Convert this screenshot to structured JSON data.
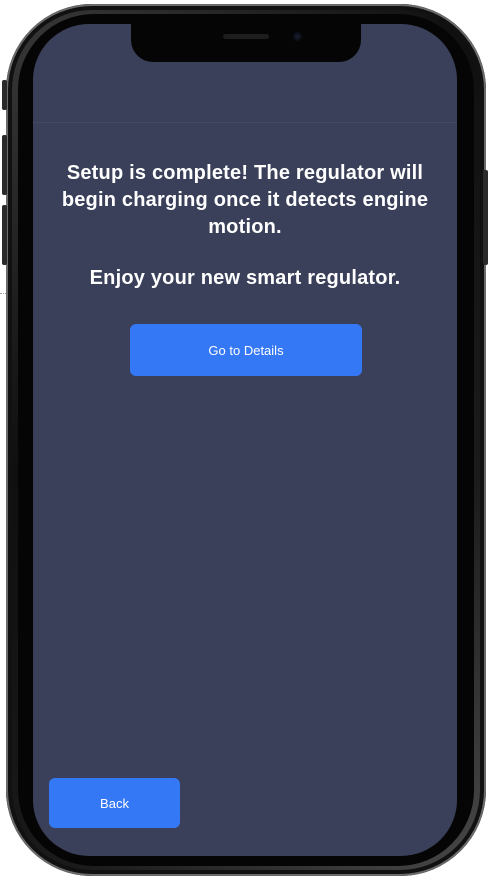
{
  "screen": {
    "background_color": "#3a4059",
    "message_line_1": "Setup is complete! The regulator will begin charging once it detects engine motion.",
    "message_line_2": "Enjoy your new smart regulator.",
    "primary_button_label": "Go to Details",
    "back_button_label": "Back",
    "button_color": "#3478f6"
  },
  "device": {
    "frame": "smartphone-with-notch"
  }
}
